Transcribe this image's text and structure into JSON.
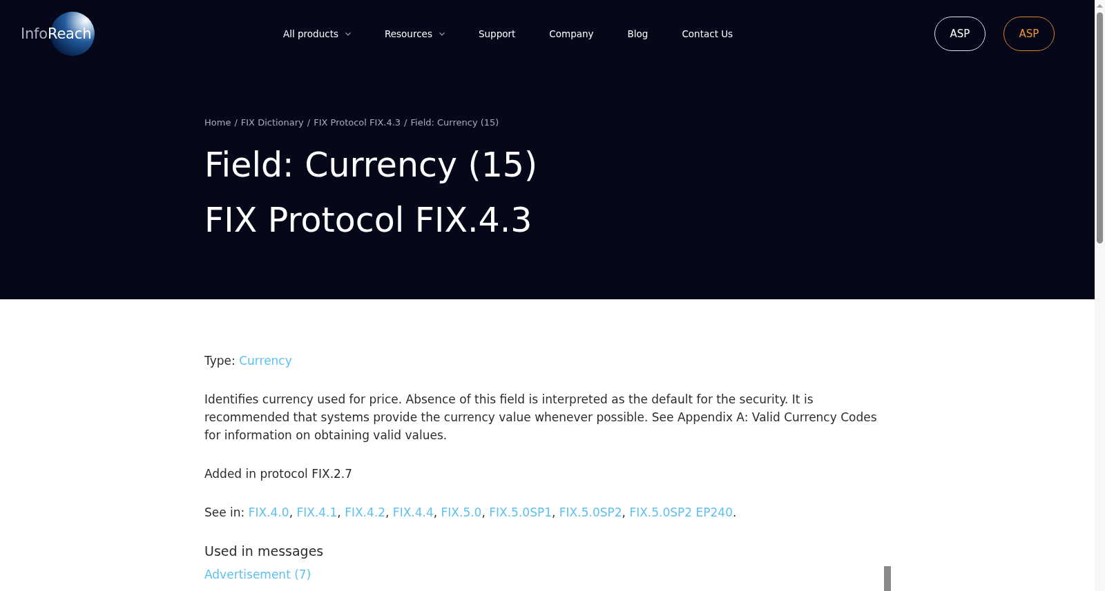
{
  "header": {
    "logo": {
      "text_light": "Info",
      "text_bright": "Reach"
    },
    "nav": [
      {
        "label": "All products",
        "has_menu": true
      },
      {
        "label": "Resources",
        "has_menu": true
      },
      {
        "label": "Support",
        "has_menu": false
      },
      {
        "label": "Company",
        "has_menu": false
      },
      {
        "label": "Blog",
        "has_menu": false
      },
      {
        "label": "Contact Us",
        "has_menu": false
      }
    ],
    "buttons": [
      {
        "label": "ASP",
        "kind": "outline"
      },
      {
        "label": "ASP",
        "kind": "accent"
      }
    ]
  },
  "hero": {
    "breadcrumb": {
      "separator": "/",
      "items": [
        "Home",
        "FIX Dictionary",
        "FIX Protocol FIX.4.3",
        "Field: Currency (15)"
      ]
    },
    "title_lines": [
      "Field: Currency (15)",
      "FIX Protocol FIX.4.3"
    ]
  },
  "content": {
    "type": {
      "label": "Type:",
      "value": "Currency"
    },
    "description": "Identifies currency used for price. Absence of this field is interpreted as the default for the security. It is recommended that systems provide the currency value whenever possible. See Appendix A: Valid Currency Codes for information on obtaining valid values.",
    "added_in": "Added in protocol FIX.2.7",
    "see_in": {
      "label": "See in:",
      "separator": ",",
      "links": [
        "FIX.4.0",
        "FIX.4.1",
        "FIX.4.2",
        "FIX.4.4",
        "FIX.5.0",
        "FIX.5.0SP1",
        "FIX.5.0SP2",
        "FIX.5.0SP2 EP240"
      ],
      "end": "."
    },
    "messages": {
      "heading": "Used in messages",
      "items": [
        "Advertisement (7)"
      ]
    }
  }
}
